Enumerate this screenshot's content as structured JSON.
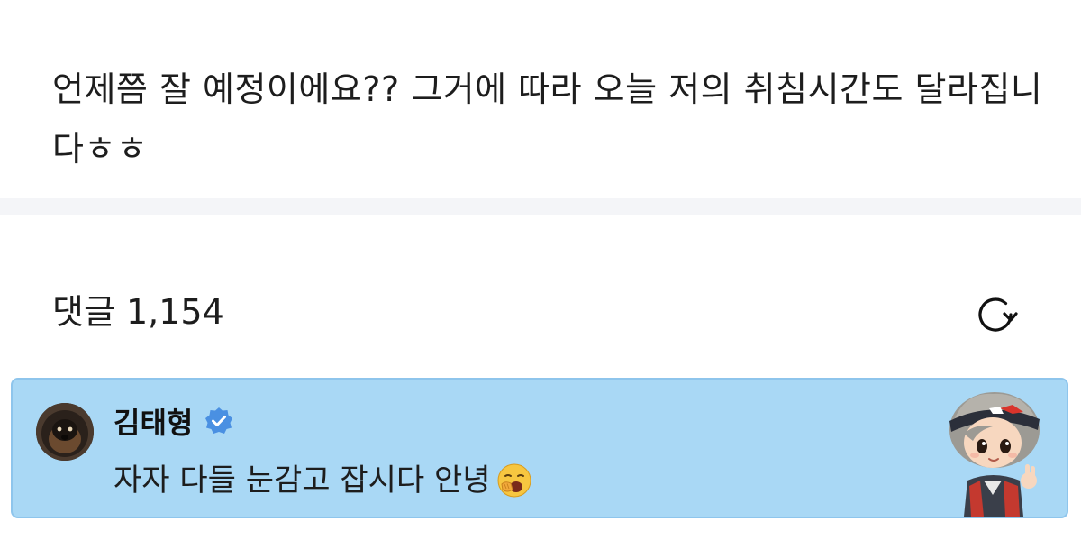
{
  "post": {
    "text": "언제쯤 잘 예정이에요?? 그거에 따라 오늘 저의 취침시간도 달라집니다ㅎㅎ"
  },
  "comments": {
    "title": "댓글 1,154",
    "refresh_icon": "refresh-icon",
    "highlighted": {
      "author": "김태형",
      "verified_icon": "verified-badge-icon",
      "text": "자자 다들 눈감고 잡시다 안녕",
      "emoji": "yawning-face-emoji",
      "background_color": "#a9d8f5",
      "border_color": "#8ec5ec"
    }
  }
}
